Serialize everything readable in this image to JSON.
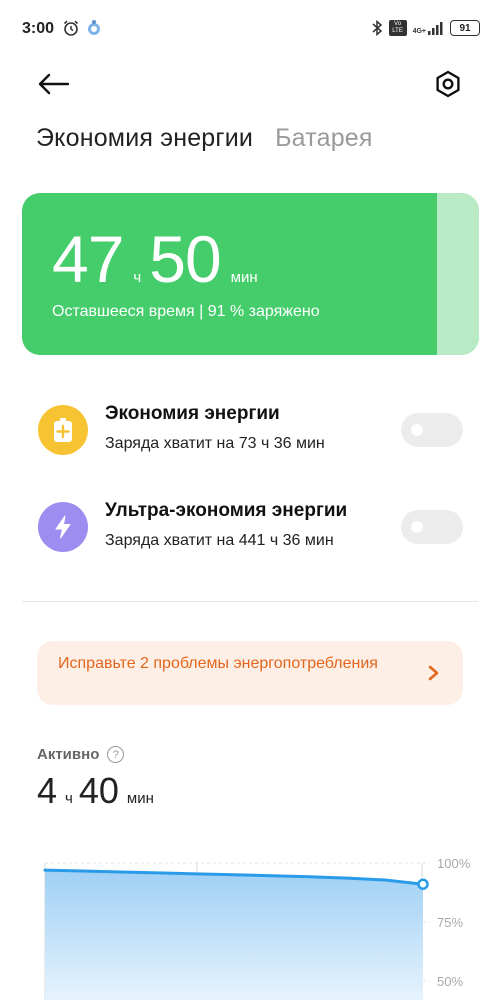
{
  "status_bar": {
    "time": "3:00",
    "battery_level": "91",
    "volte_label": "Vo LTE",
    "network_label": "4G+"
  },
  "tabs": [
    {
      "label": "Экономия энергии",
      "active": true
    },
    {
      "label": "Батарея",
      "active": false
    }
  ],
  "remaining": {
    "hours": "47",
    "hours_unit": "ч",
    "minutes": "50",
    "minutes_unit": "мин",
    "subtitle": "Оставшееся время | 91 % заряжено",
    "charge_fraction": 0.91
  },
  "modes": [
    {
      "title": "Экономия энергии",
      "subtitle": "Заряда хватит на 73 ч 36 мин",
      "enabled": false,
      "icon": "battery-plus-icon",
      "icon_color": "#f6c332"
    },
    {
      "title": "Ультра-экономия энергии",
      "subtitle": "Заряда хватит на 441 ч 36 мин",
      "enabled": false,
      "icon": "lightning-icon",
      "icon_color": "#9d8df1"
    }
  ],
  "issues": {
    "text": "Исправьте 2 проблемы энергопотребления"
  },
  "active": {
    "label": "Активно",
    "help": "?",
    "hours": "4",
    "hours_unit": "ч",
    "minutes": "40",
    "minutes_unit": "мин"
  },
  "colors": {
    "card_green": "#45cd6b",
    "accent_orange": "#e2671d",
    "chart_line": "#2a9be8"
  },
  "chart_data": {
    "type": "area",
    "y_tick_labels": [
      "100%",
      "75%",
      "50%"
    ],
    "ylim": [
      50,
      100
    ],
    "series": [
      {
        "values": [
          97,
          96.6,
          96.2,
          95.8,
          95.4,
          95,
          94.6,
          94.2,
          93.6,
          92.8,
          91
        ]
      }
    ],
    "grid": true
  }
}
